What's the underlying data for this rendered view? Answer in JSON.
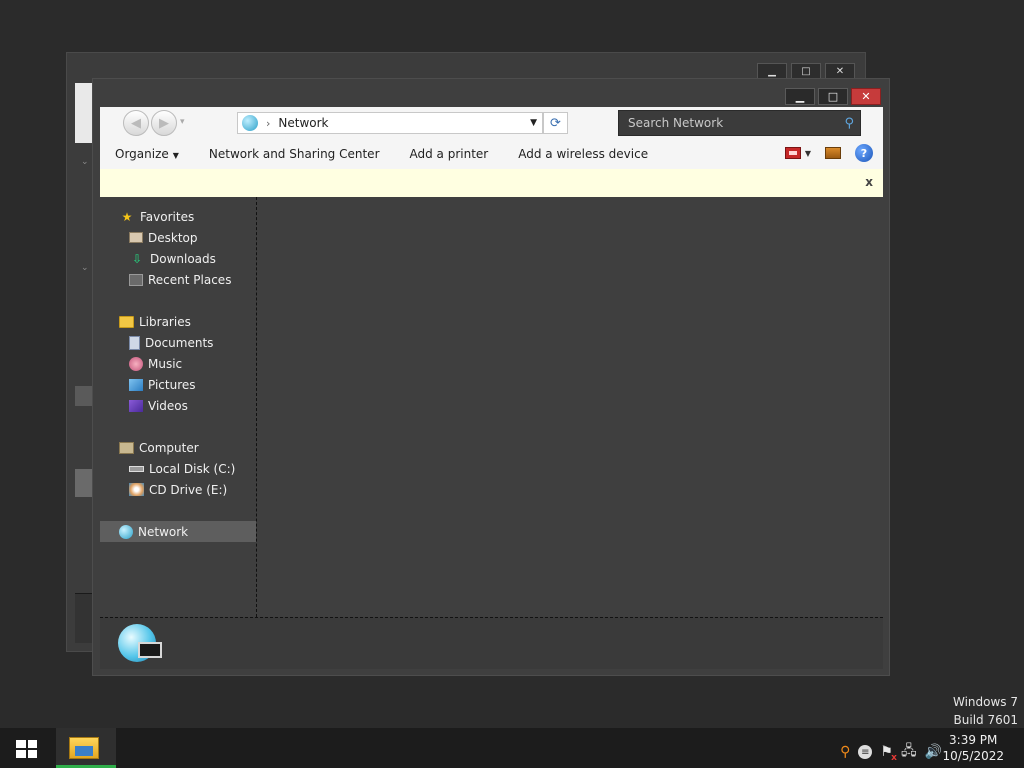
{
  "bg_window": {
    "minimize": "▁",
    "maximize": "□",
    "close": "✕"
  },
  "explorer": {
    "caption": {
      "minimize": "▁",
      "maximize": "□",
      "close": "✕"
    },
    "nav": {
      "back": "◀",
      "forward": "▶",
      "history_dropdown": "▾"
    },
    "address": {
      "location": "Network",
      "separator": "›",
      "dropdown": "▼",
      "refresh": "⟳"
    },
    "search": {
      "placeholder": "Search Network",
      "icon": "search-icon"
    },
    "toolbar": {
      "organize": "Organize",
      "organize_arrow": "▼",
      "network_sharing": "Network and Sharing Center",
      "add_printer": "Add a printer",
      "add_wireless": "Add a wireless device",
      "view_arrow": "▼",
      "help": "?"
    },
    "infobar": {
      "close": "x"
    },
    "sidebar": {
      "favorites": "Favorites",
      "desktop": "Desktop",
      "downloads": "Downloads",
      "recent_places": "Recent Places",
      "libraries": "Libraries",
      "documents": "Documents",
      "music": "Music",
      "pictures": "Pictures",
      "videos": "Videos",
      "computer": "Computer",
      "local_disk": "Local Disk (C:)",
      "cd_drive": "CD Drive (E:)",
      "network": "Network",
      "download_glyph": "⇩",
      "star_glyph": "★"
    }
  },
  "desktop": {
    "os_name": "Windows 7",
    "build": "Build 7601"
  },
  "taskbar": {
    "tray": {
      "search_glyph": "⚲",
      "message_glyph": "≡",
      "flag_glyph": "⚑",
      "network_glyph": "🖧",
      "volume_glyph": "🔊"
    },
    "clock": {
      "time": "3:39 PM",
      "date": "10/5/2022"
    }
  },
  "colors": {
    "desktop_bg": "#2b2b2b",
    "window_bg": "#3f3f3f",
    "close_button": "#c63b3b",
    "infobar": "#ffffe1",
    "taskbar": "#1c1c1c",
    "active_app_indicator": "#2fae4a"
  }
}
